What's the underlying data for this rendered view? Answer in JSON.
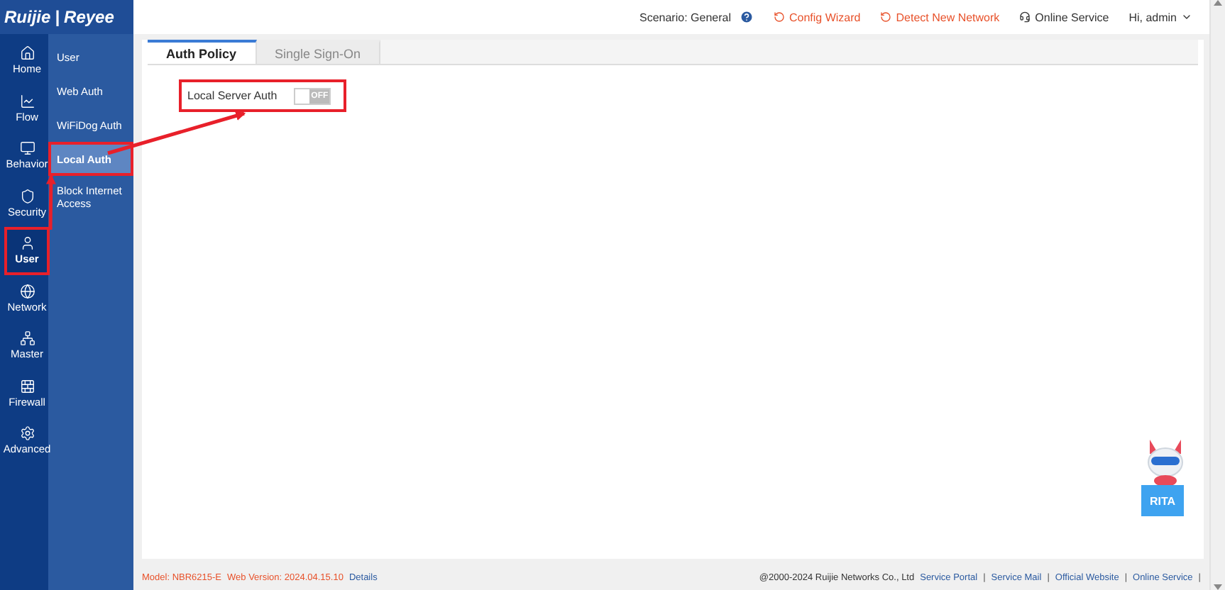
{
  "logo": {
    "brand": "Ruijie",
    "separator": "|",
    "product": "Reyee"
  },
  "header": {
    "scenario_label": "Scenario:",
    "scenario_value": "General",
    "links": [
      {
        "kind": "wizard",
        "label": "Config Wizard"
      },
      {
        "kind": "wizard",
        "label": "Detect New Network"
      },
      {
        "kind": "service",
        "label": "Online Service"
      }
    ],
    "user": "Hi, admin"
  },
  "nav": [
    {
      "kind": "home",
      "label": "Home",
      "selected": false,
      "highlighted": false
    },
    {
      "kind": "flow",
      "label": "Flow",
      "selected": false,
      "highlighted": false
    },
    {
      "kind": "behavior",
      "label": "Behavior",
      "selected": false,
      "highlighted": false
    },
    {
      "kind": "security",
      "label": "Security",
      "selected": false,
      "highlighted": false
    },
    {
      "kind": "user",
      "label": "User",
      "selected": true,
      "highlighted": true
    },
    {
      "kind": "network",
      "label": "Network",
      "selected": false,
      "highlighted": false
    },
    {
      "kind": "master",
      "label": "Master",
      "selected": false,
      "highlighted": false
    },
    {
      "kind": "firewall",
      "label": "Firewall",
      "selected": false,
      "highlighted": false
    },
    {
      "kind": "advanced",
      "label": "Advanced",
      "selected": false,
      "highlighted": false
    }
  ],
  "submenu": [
    {
      "label": "User",
      "selected": false,
      "highlighted": false
    },
    {
      "label": "Web Auth",
      "selected": false,
      "highlighted": false
    },
    {
      "label": "WiFiDog Auth",
      "selected": false,
      "highlighted": false
    },
    {
      "label": "Local Auth",
      "selected": true,
      "highlighted": true
    },
    {
      "label": "Block Internet Access",
      "selected": false,
      "highlighted": false
    }
  ],
  "tabs": [
    {
      "label": "Auth Policy",
      "selected": true
    },
    {
      "label": "Single Sign-On",
      "selected": false
    }
  ],
  "settings": [
    {
      "label": "Local Server Auth",
      "on": false,
      "toggle_text": "OFF",
      "highlighted": true
    }
  ],
  "assistant": {
    "label": "RITA"
  },
  "footer": {
    "model_label": "Model:",
    "model": "NBR6215-E",
    "version_label": "Web Version:",
    "version": "2024.04.15.10",
    "details": "Details",
    "copyright": "@2000-2024 Ruijie Networks Co., Ltd",
    "links": [
      "Service Portal",
      "Service Mail",
      "Official Website",
      "Online Service"
    ],
    "separator": "|"
  }
}
